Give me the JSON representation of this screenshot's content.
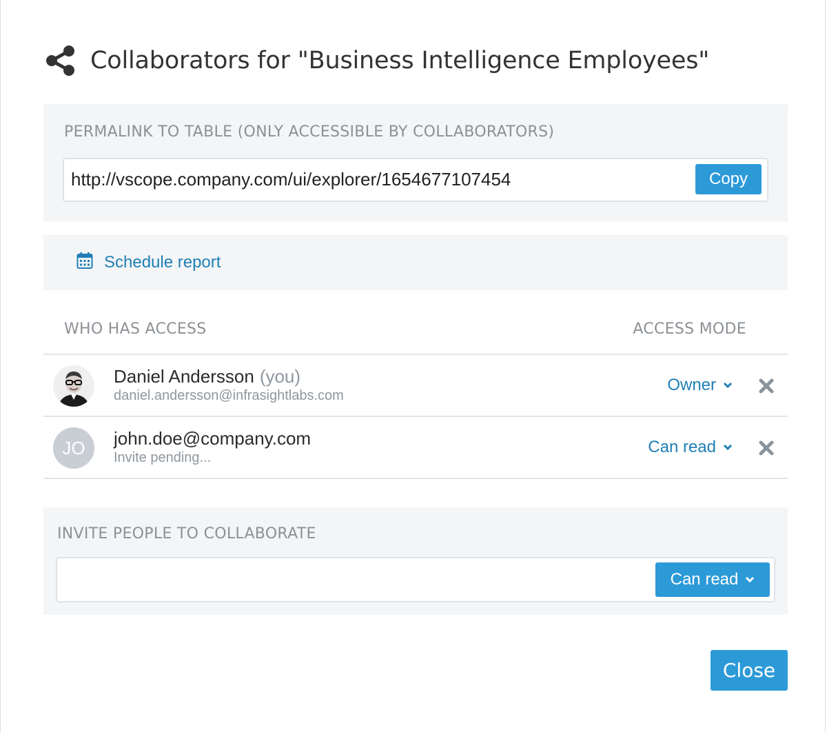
{
  "dialog": {
    "title": "Collaborators for \"Business Intelligence Employees\"",
    "icon": "share-icon"
  },
  "permalink": {
    "label": "PERMALINK TO TABLE (ONLY ACCESSIBLE BY COLLABORATORS)",
    "url": "http://vscope.company.com/ui/explorer/1654677107454",
    "copy_label": "Copy"
  },
  "schedule": {
    "icon": "calendar-icon",
    "label": "Schedule report"
  },
  "access": {
    "who_label": "WHO HAS ACCESS",
    "mode_label": "ACCESS MODE",
    "people": [
      {
        "name": "Daniel Andersson",
        "you_tag": "(you)",
        "sub": "daniel.andersson@infrasightlabs.com",
        "mode": "Owner",
        "avatar": "photo"
      },
      {
        "name": "john.doe@company.com",
        "sub": "Invite pending...",
        "mode": "Can read",
        "initials": "JO"
      }
    ]
  },
  "invite": {
    "label": "INVITE PEOPLE TO COLLABORATE",
    "value": "",
    "placeholder": "",
    "mode_label": "Can read"
  },
  "footer": {
    "close_label": "Close"
  },
  "colors": {
    "accent": "#2d9ad8",
    "link": "#1f7fb5",
    "panel_bg": "#f3f5f7",
    "muted_text": "#8c9196"
  }
}
